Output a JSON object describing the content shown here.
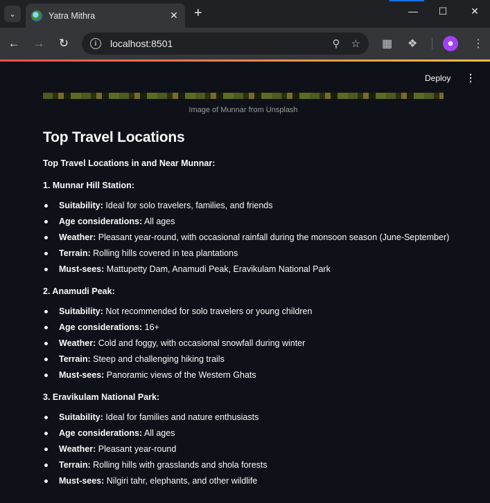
{
  "browser": {
    "tab_title": "Yatra Mithra",
    "url": "localhost:8501"
  },
  "app": {
    "deploy_label": "Deploy",
    "image_caption": "Image of Munnar from Unsplash",
    "heading": "Top Travel Locations",
    "subheading": "Top Travel Locations in and Near Munnar:",
    "locations": [
      {
        "title": "1. Munnar Hill Station:",
        "items": [
          {
            "label": "Suitability:",
            "text": "Ideal for solo travelers, families, and friends"
          },
          {
            "label": "Age considerations:",
            "text": "All ages"
          },
          {
            "label": "Weather:",
            "text": "Pleasant year-round, with occasional rainfall during the monsoon season (June-September)"
          },
          {
            "label": "Terrain:",
            "text": "Rolling hills covered in tea plantations"
          },
          {
            "label": "Must-sees:",
            "text": "Mattupetty Dam, Anamudi Peak, Eravikulam National Park"
          }
        ]
      },
      {
        "title": "2. Anamudi Peak:",
        "items": [
          {
            "label": "Suitability:",
            "text": "Not recommended for solo travelers or young children"
          },
          {
            "label": "Age considerations:",
            "text": "16+"
          },
          {
            "label": "Weather:",
            "text": "Cold and foggy, with occasional snowfall during winter"
          },
          {
            "label": "Terrain:",
            "text": "Steep and challenging hiking trails"
          },
          {
            "label": "Must-sees:",
            "text": "Panoramic views of the Western Ghats"
          }
        ]
      },
      {
        "title": "3. Eravikulam National Park:",
        "items": [
          {
            "label": "Suitability:",
            "text": "Ideal for families and nature enthusiasts"
          },
          {
            "label": "Age considerations:",
            "text": "All ages"
          },
          {
            "label": "Weather:",
            "text": "Pleasant year-round"
          },
          {
            "label": "Terrain:",
            "text": "Rolling hills with grasslands and shola forests"
          },
          {
            "label": "Must-sees:",
            "text": "Nilgiri tahr, elephants, and other wildlife"
          }
        ]
      }
    ]
  }
}
